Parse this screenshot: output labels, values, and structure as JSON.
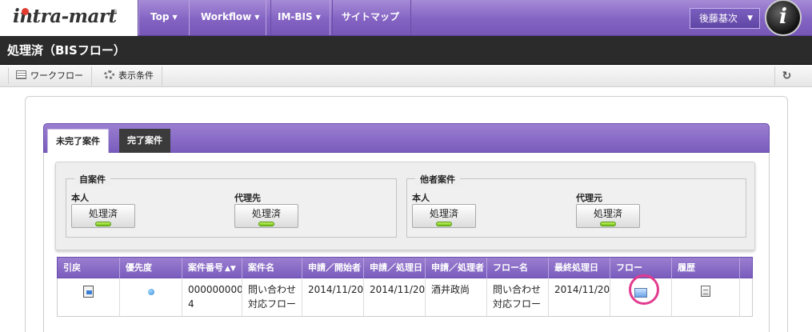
{
  "nav": {
    "logo": "intra-mart",
    "items": [
      {
        "label": "Top",
        "has_menu": true
      },
      {
        "label": "Workflow",
        "has_menu": true
      },
      {
        "label": "IM-BIS",
        "has_menu": true
      },
      {
        "label": "サイトマップ",
        "has_menu": false
      }
    ],
    "user": "後藤基次",
    "brand_mark": "i"
  },
  "title": "処理済（BISフロー）",
  "toolbar": {
    "workflow_label": "ワークフロー",
    "display_condition_label": "表示条件",
    "refresh_icon": "refresh-icon"
  },
  "tabs": [
    {
      "label": "未完了案件",
      "active": true
    },
    {
      "label": "完了案件",
      "active": false
    }
  ],
  "filters": {
    "own": {
      "legend": "自案件",
      "groups": [
        {
          "label": "本人",
          "button": "処理済"
        },
        {
          "label": "代理先",
          "button": "処理済"
        }
      ]
    },
    "others": {
      "legend": "他者案件",
      "groups": [
        {
          "label": "本人",
          "button": "処理済"
        },
        {
          "label": "代理元",
          "button": "処理済"
        }
      ]
    }
  },
  "table": {
    "columns": [
      "引戻",
      "優先度",
      "案件番号",
      "案件名",
      "申請／開始者",
      "申請／処理日",
      "申請／処理者",
      "フロー名",
      "最終処理日",
      "フロー",
      "履歴"
    ],
    "rows": [
      {
        "case_number_line1": "000000000",
        "case_number_line2": "4",
        "case_name_line1": "問い合わせ",
        "case_name_line2": "対応フロー",
        "start_date": "2014/11/20",
        "process_date": "2014/11/20",
        "processor": "酒井政尚",
        "flow_name_line1": "問い合わせ",
        "flow_name_line2": "対応フロー",
        "last_processed": "2014/11/20"
      }
    ]
  },
  "colors": {
    "accent_purple": "#8463c3",
    "title_bar": "#2b2b2b",
    "highlight_circle": "#e23a8e",
    "led_green": "#6ebf12"
  }
}
